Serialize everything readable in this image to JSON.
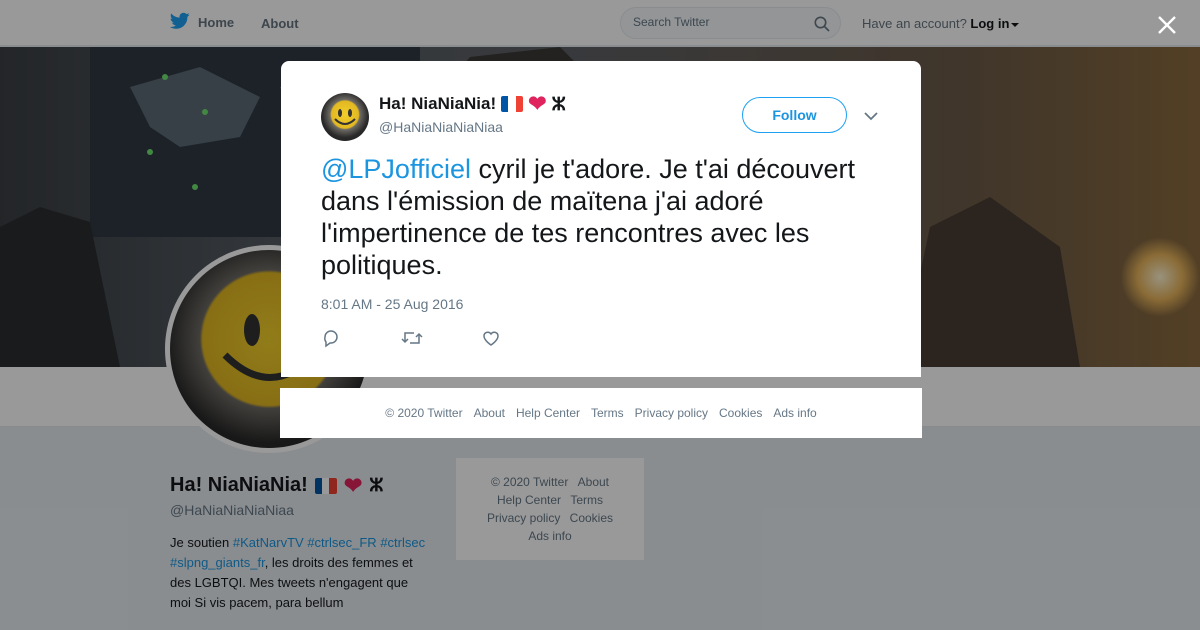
{
  "nav": {
    "home_label": "Home",
    "about_label": "About",
    "search_placeholder": "Search Twitter",
    "account_prompt": "Have an account?",
    "login_label": "Log in"
  },
  "profile": {
    "name": "Ha! NiaNiaNia!",
    "handle": "@HaNiaNiaNiaNiaa",
    "bio": {
      "prefix": "Je soutien",
      "hashtags_line1": [
        "#KatNarvTV",
        "#ctrlsec_FR"
      ],
      "hashtags_line2": [
        "#ctrlsec",
        "#slpng_giants_fr"
      ],
      "suffix": ", les droits des femmes et des LGBTQI. Mes tweets n'engagent que moi Si vis pacem, para bellum"
    },
    "name_symbols": {
      "flag": "french-flag",
      "heart": "❤",
      "amazigh": "ⵣ"
    }
  },
  "sidebar_footer": {
    "items": [
      "© 2020 Twitter",
      "About",
      "Help Center",
      "Terms",
      "Privacy policy",
      "Cookies",
      "Ads info"
    ]
  },
  "tweet": {
    "author_name": "Ha! NiaNiaNia!",
    "author_handle": "@HaNiaNiaNiaNiaa",
    "follow_label": "Follow",
    "mention": "@LPJofficiel",
    "text": " cyril je t'adore. Je t'ai découvert dans l'émission de maïtena j'ai adoré l'impertinence de tes rencontres avec les politiques.",
    "timestamp": "8:01 AM - 25 Aug 2016"
  },
  "modal_footer": {
    "items": [
      "© 2020 Twitter",
      "About",
      "Help Center",
      "Terms",
      "Privacy policy",
      "Cookies",
      "Ads info"
    ]
  },
  "colors": {
    "accent": "#1da1f2",
    "link": "#1b95e0",
    "heart": "#e0245e",
    "muted": "#657786"
  }
}
